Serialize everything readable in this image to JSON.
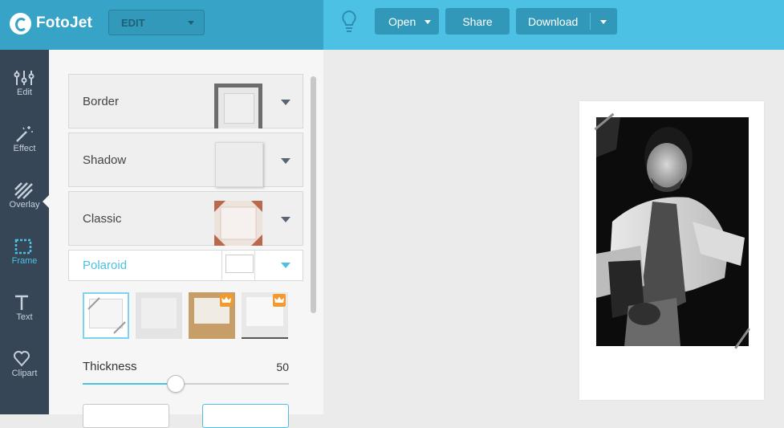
{
  "app": {
    "name": "FotoJet"
  },
  "toolbar": {
    "mode": "EDIT",
    "open_label": "Open",
    "share_label": "Share",
    "download_label": "Download"
  },
  "nav": {
    "items": [
      {
        "label": "Edit",
        "icon": "sliders-icon"
      },
      {
        "label": "Effect",
        "icon": "magic-wand-icon"
      },
      {
        "label": "Overlay",
        "icon": "hatch-icon"
      },
      {
        "label": "Frame",
        "icon": "frame-icon"
      },
      {
        "label": "Text",
        "icon": "text-icon"
      },
      {
        "label": "Clipart",
        "icon": "heart-icon"
      }
    ],
    "active": "Frame"
  },
  "panel": {
    "sections": [
      {
        "label": "Border"
      },
      {
        "label": "Shadow"
      },
      {
        "label": "Classic"
      },
      {
        "label": "Polaroid"
      }
    ],
    "thickness": {
      "label": "Thickness",
      "value": "50",
      "fraction": 0.45
    }
  },
  "colors": {
    "accent": "#4cc1e3",
    "topbar_left": "#37a3c6",
    "topbar_right": "#4cc1e3",
    "nav_bg": "#364657",
    "premium": "#f29a2e"
  }
}
